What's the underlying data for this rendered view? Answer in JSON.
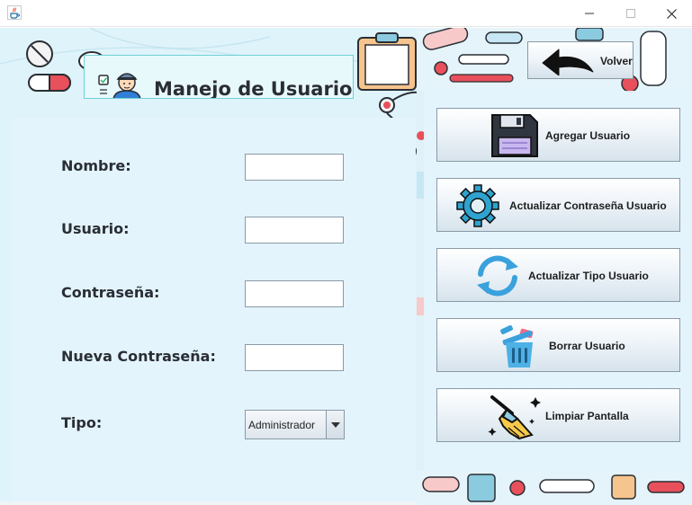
{
  "window": {
    "app_icon": "java-icon",
    "controls": {
      "minimize": "minimize-icon",
      "maximize": "maximize-icon",
      "close": "close-icon"
    }
  },
  "header": {
    "title": "Manejo de Usuarios"
  },
  "nav": {
    "back_label": "Volver",
    "back_icon": "back-arrow-icon"
  },
  "form": {
    "nombre": {
      "label": "Nombre:",
      "value": ""
    },
    "usuario": {
      "label": "Usuario:",
      "value": ""
    },
    "contrasena": {
      "label": "Contraseña:",
      "value": ""
    },
    "nueva_contrasena": {
      "label": "Nueva Contraseña:",
      "value": ""
    },
    "tipo": {
      "label": "Tipo:",
      "selected": "Administrador"
    }
  },
  "actions": [
    {
      "label": "Agregar Usuario",
      "icon": "floppy-disk-icon"
    },
    {
      "label": "Actualizar Contraseña Usuario",
      "icon": "gear-icon"
    },
    {
      "label": "Actualizar Tipo Usuario",
      "icon": "refresh-icon"
    },
    {
      "label": "Borrar Usuario",
      "icon": "trash-icon"
    },
    {
      "label": "Limpiar Pantalla",
      "icon": "broom-icon"
    }
  ],
  "colors": {
    "background": "#dff3fb",
    "panel": "#e3f4fd",
    "header_border": "#6fd0d4",
    "text": "#2a2e34"
  }
}
